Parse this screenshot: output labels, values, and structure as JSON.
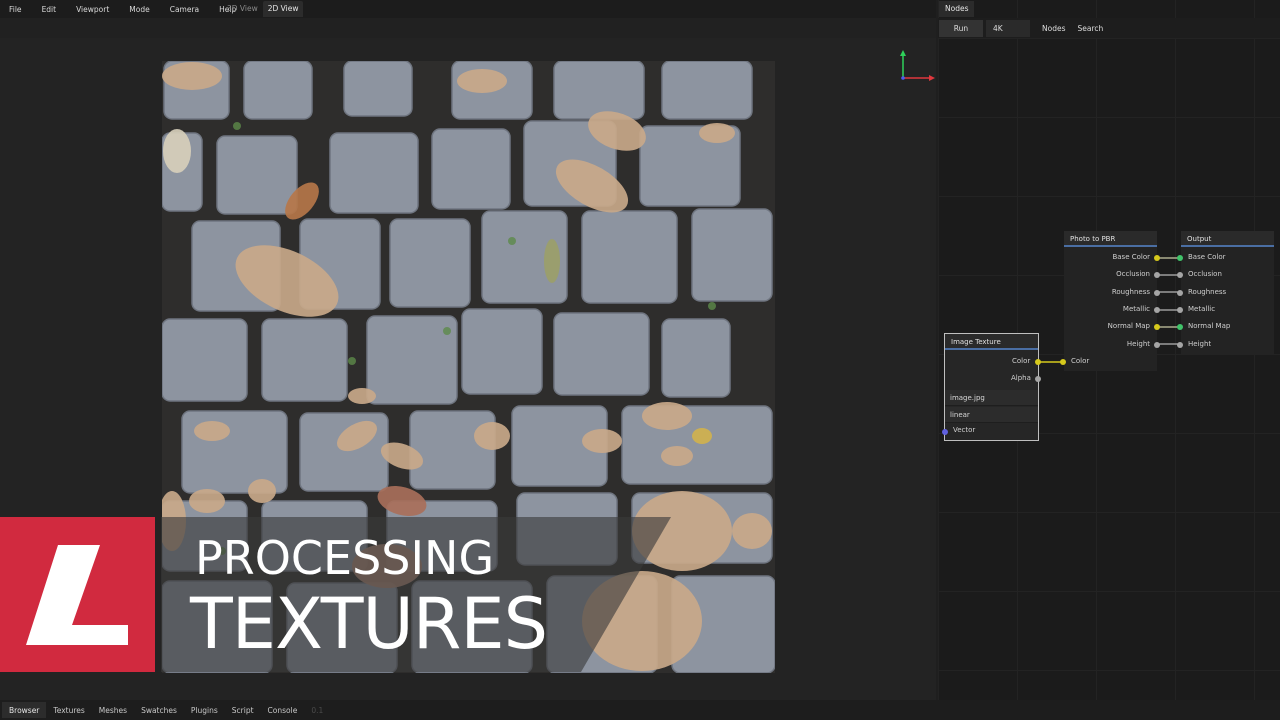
{
  "menu": [
    "File",
    "Edit",
    "Viewport",
    "Mode",
    "Camera",
    "Help"
  ],
  "view_tabs": [
    {
      "label": "3D View",
      "active": false
    },
    {
      "label": "2D View",
      "active": true
    }
  ],
  "nodes_panel": {
    "tab": "Nodes",
    "toolbar": {
      "run": "Run",
      "resolution": "4K",
      "nodes": "Nodes",
      "search": "Search"
    }
  },
  "node_image_texture": {
    "title": "Image Texture",
    "outputs": [
      "Color",
      "Alpha"
    ],
    "file": "image.jpg",
    "interpolation": "linear",
    "input": "Vector"
  },
  "node_photo_to_pbr": {
    "title": "Photo to PBR",
    "input_label": "Color",
    "outputs": [
      "Base Color",
      "Occlusion",
      "Roughness",
      "Metallic",
      "Normal Map",
      "Height"
    ]
  },
  "node_output": {
    "title": "Output",
    "inputs": [
      "Base Color",
      "Occlusion",
      "Roughness",
      "Metallic",
      "Normal Map",
      "Height"
    ]
  },
  "lower_third": {
    "line1": "PROCESSING",
    "line2": "TEXTURES"
  },
  "bottom_tabs": [
    "Browser",
    "Textures",
    "Meshes",
    "Swatches",
    "Plugins",
    "Script",
    "Console"
  ],
  "bottom_version": "0.1",
  "colors": {
    "accent_red": "#d12a3f",
    "socket_yellow": "#d6c91c",
    "socket_green": "#40c46a",
    "node_header": "#4a6ea3"
  }
}
